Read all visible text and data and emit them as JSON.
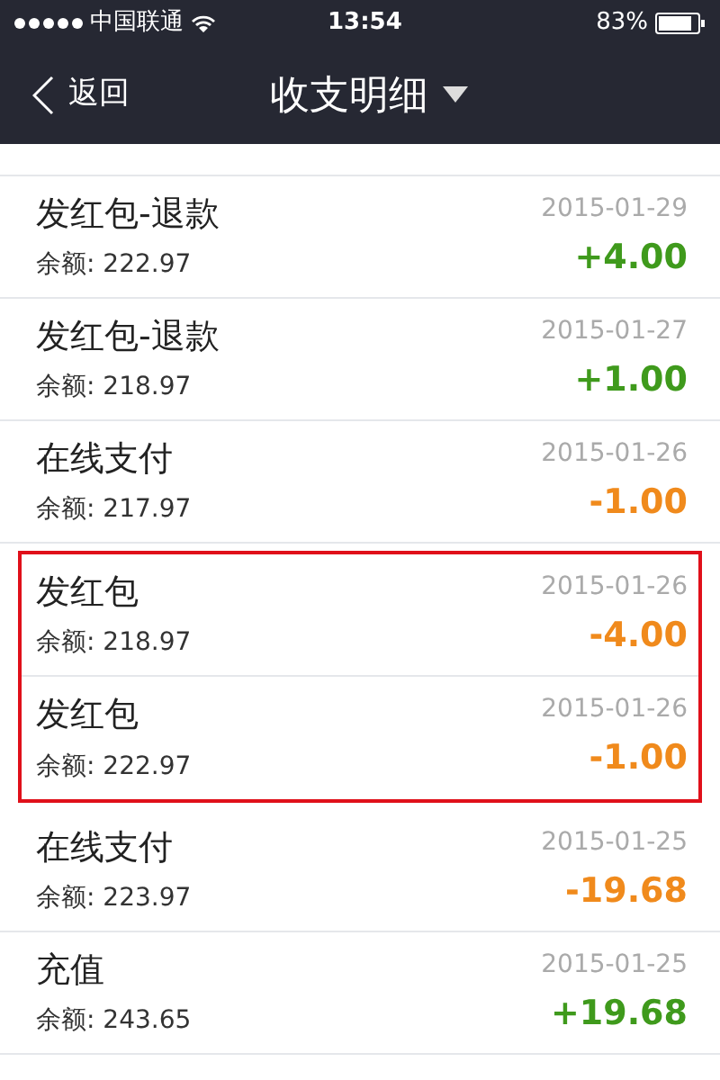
{
  "status_bar": {
    "carrier": "中国联通",
    "time": "13:54",
    "battery": "83%"
  },
  "nav": {
    "back": "返回",
    "title": "收支明细"
  },
  "transactions": [
    {
      "title": "发红包-退款",
      "balance": "余额: 222.97",
      "date": "2015-01-29",
      "amount": "+4.00",
      "kind": "income",
      "highlighted": false
    },
    {
      "title": "发红包-退款",
      "balance": "余额: 218.97",
      "date": "2015-01-27",
      "amount": "+1.00",
      "kind": "income",
      "highlighted": false
    },
    {
      "title": "在线支付",
      "balance": "余额: 217.97",
      "date": "2015-01-26",
      "amount": "-1.00",
      "kind": "expense",
      "highlighted": false
    },
    {
      "title": "发红包",
      "balance": "余额: 218.97",
      "date": "2015-01-26",
      "amount": "-4.00",
      "kind": "expense",
      "highlighted": true
    },
    {
      "title": "发红包",
      "balance": "余额: 222.97",
      "date": "2015-01-26",
      "amount": "-1.00",
      "kind": "expense",
      "highlighted": true
    },
    {
      "title": "在线支付",
      "balance": "余额: 223.97",
      "date": "2015-01-25",
      "amount": "-19.68",
      "kind": "expense",
      "highlighted": false
    },
    {
      "title": "充值",
      "balance": "余额: 243.65",
      "date": "2015-01-25",
      "amount": "+19.68",
      "kind": "income",
      "highlighted": false
    }
  ]
}
